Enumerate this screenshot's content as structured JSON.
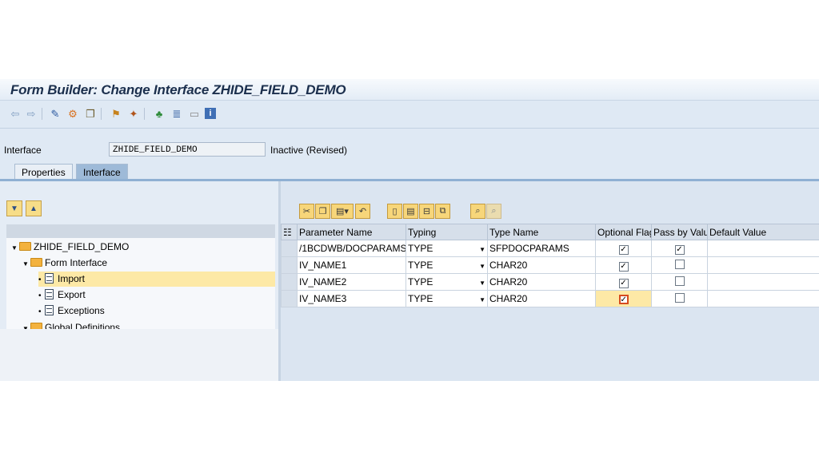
{
  "window": {
    "title": "Form Builder: Change Interface ZHIDE_FIELD_DEMO"
  },
  "toolbar": {
    "icons": [
      "back-arrow-icon",
      "forward-arrow-icon",
      "display-change-icon",
      "active-inactive-icon",
      "other-object-icon",
      "where-used-icon",
      "check-icon",
      "activate-icon",
      "hierarchy-icon",
      "layout-icon",
      "display-object-list-icon",
      "info-icon"
    ]
  },
  "header": {
    "interface_label": "Interface",
    "interface_value": "ZHIDE_FIELD_DEMO",
    "status": "Inactive (Revised)"
  },
  "tabs": [
    {
      "label": "Properties"
    },
    {
      "label": "Interface"
    }
  ],
  "tree": {
    "nodes": [
      {
        "label": "ZHIDE_FIELD_DEMO"
      },
      {
        "label": "Form Interface"
      },
      {
        "label": "Import"
      },
      {
        "label": "Export"
      },
      {
        "label": "Exceptions"
      },
      {
        "label": "Global Definitions"
      }
    ]
  },
  "grid": {
    "columns": [
      "Parameter Name",
      "Typing",
      "Type Name",
      "Optional Flag",
      "Pass by Value",
      "Default Value"
    ],
    "rows": [
      {
        "param": "/1BCDWB/DOCPARAMS",
        "typing": "TYPE",
        "type_name": "SFPDOCPARAMS",
        "optional": true,
        "pass_by_value": true,
        "default": ""
      },
      {
        "param": "IV_NAME1",
        "typing": "TYPE",
        "type_name": "CHAR20",
        "optional": true,
        "pass_by_value": false,
        "default": ""
      },
      {
        "param": "IV_NAME2",
        "typing": "TYPE",
        "type_name": "CHAR20",
        "optional": true,
        "pass_by_value": false,
        "default": ""
      },
      {
        "param": "IV_NAME3",
        "typing": "TYPE",
        "type_name": "CHAR20",
        "optional": true,
        "pass_by_value": false,
        "default": ""
      }
    ],
    "checked_glyph": "✓"
  },
  "colors": {
    "accent": "#8fb0d3",
    "selection": "#fde9a6",
    "toolbar_button": "#f7d67a"
  }
}
